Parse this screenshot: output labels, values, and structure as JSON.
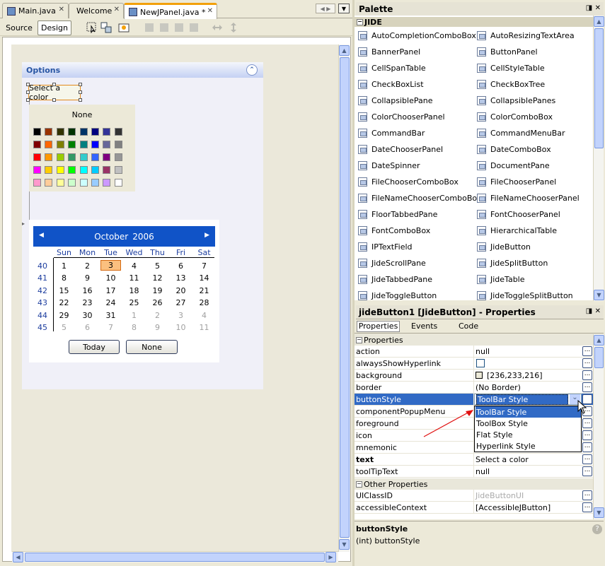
{
  "editor_tabs": [
    {
      "label": "Main.java",
      "active": false
    },
    {
      "label": "Welcome",
      "active": false
    },
    {
      "label": "NewJPanel.java *",
      "active": true
    }
  ],
  "toolbar": {
    "source_label": "Source",
    "design_label": "Design"
  },
  "options_panel": {
    "title": "Options"
  },
  "color_button": {
    "label": "Select a color"
  },
  "color_picker": {
    "none_label": "None",
    "colors": [
      [
        "#000000",
        "#993300",
        "#333300",
        "#003300",
        "#003366",
        "#000080",
        "#333399",
        "#333333"
      ],
      [
        "#800000",
        "#ff6600",
        "#808000",
        "#008000",
        "#008080",
        "#0000ff",
        "#666699",
        "#808080"
      ],
      [
        "#ff0000",
        "#ff9900",
        "#99cc00",
        "#339966",
        "#33cccc",
        "#3366ff",
        "#800080",
        "#969696"
      ],
      [
        "#ff00ff",
        "#ffcc00",
        "#ffff00",
        "#00ff00",
        "#00ffff",
        "#00ccff",
        "#993366",
        "#c0c0c0"
      ],
      [
        "#ff99cc",
        "#ffcc99",
        "#ffff99",
        "#ccffcc",
        "#ccffff",
        "#99ccff",
        "#cc99ff",
        "#ffffff"
      ]
    ]
  },
  "calendar": {
    "month": "October",
    "year": "2006",
    "weekdays": [
      "Sun",
      "Mon",
      "Tue",
      "Wed",
      "Thu",
      "Fri",
      "Sat"
    ],
    "weeks": [
      "40",
      "41",
      "42",
      "43",
      "44",
      "45"
    ],
    "days": [
      [
        "1",
        "2",
        "3",
        "4",
        "5",
        "6",
        "7"
      ],
      [
        "8",
        "9",
        "10",
        "11",
        "12",
        "13",
        "14"
      ],
      [
        "15",
        "16",
        "17",
        "18",
        "19",
        "20",
        "21"
      ],
      [
        "22",
        "23",
        "24",
        "25",
        "26",
        "27",
        "28"
      ],
      [
        "29",
        "30",
        "31",
        "1",
        "2",
        "3",
        "4"
      ],
      [
        "5",
        "6",
        "7",
        "8",
        "9",
        "10",
        "11"
      ]
    ],
    "selected_day": "3",
    "today_label": "Today",
    "none_label": "None"
  },
  "palette": {
    "title": "Palette",
    "category": "JIDE",
    "items": [
      [
        "AutoCompletionComboBox",
        "AutoResizingTextArea"
      ],
      [
        "BannerPanel",
        "ButtonPanel"
      ],
      [
        "CellSpanTable",
        "CellStyleTable"
      ],
      [
        "CheckBoxList",
        "CheckBoxTree"
      ],
      [
        "CollapsiblePane",
        "CollapsiblePanes"
      ],
      [
        "ColorChooserPanel",
        "ColorComboBox"
      ],
      [
        "CommandBar",
        "CommandMenuBar"
      ],
      [
        "DateChooserPanel",
        "DateComboBox"
      ],
      [
        "DateSpinner",
        "DocumentPane"
      ],
      [
        "FileChooserComboBox",
        "FileChooserPanel"
      ],
      [
        "FileNameChooserComboBox",
        "FileNameChooserPanel"
      ],
      [
        "FloorTabbedPane",
        "FontChooserPanel"
      ],
      [
        "FontComboBox",
        "HierarchicalTable"
      ],
      [
        "IPTextField",
        "JideButton"
      ],
      [
        "JideScrollPane",
        "JideSplitButton"
      ],
      [
        "JideTabbedPane",
        "JideTable"
      ],
      [
        "JideToggleButton",
        "JideToggleSplitButton"
      ]
    ]
  },
  "properties": {
    "title": "jideButton1 [JideButton] - Properties",
    "tabs": [
      "Properties",
      "Events",
      "Code"
    ],
    "section1": "Properties",
    "section2": "Other Properties",
    "rows": [
      {
        "name": "action",
        "value": "null"
      },
      {
        "name": "alwaysShowHyperlink",
        "value": ""
      },
      {
        "name": "background",
        "value": "[236,233,216]"
      },
      {
        "name": "border",
        "value": "(No Border)"
      },
      {
        "name": "buttonStyle",
        "value": "ToolBar Style"
      },
      {
        "name": "componentPopupMenu",
        "value": ""
      },
      {
        "name": "foreground",
        "value": ""
      },
      {
        "name": "icon",
        "value": ""
      },
      {
        "name": "mnemonic",
        "value": ""
      },
      {
        "name": "text",
        "value": "Select a color"
      },
      {
        "name": "toolTipText",
        "value": "null"
      }
    ],
    "other_rows": [
      {
        "name": "UIClassID",
        "value": "JideButtonUI"
      },
      {
        "name": "accessibleContext",
        "value": "[AccessibleJButton]"
      }
    ],
    "dropdown_options": [
      "ToolBar Style",
      "ToolBox Style",
      "Flat Style",
      "Hyperlink Style"
    ],
    "description_title": "buttonStyle",
    "description_text": "(int) buttonStyle"
  },
  "colors": {
    "selection": "#316ac5",
    "accent_orange": "#f2a00a",
    "calendar_header": "#1053c7"
  }
}
